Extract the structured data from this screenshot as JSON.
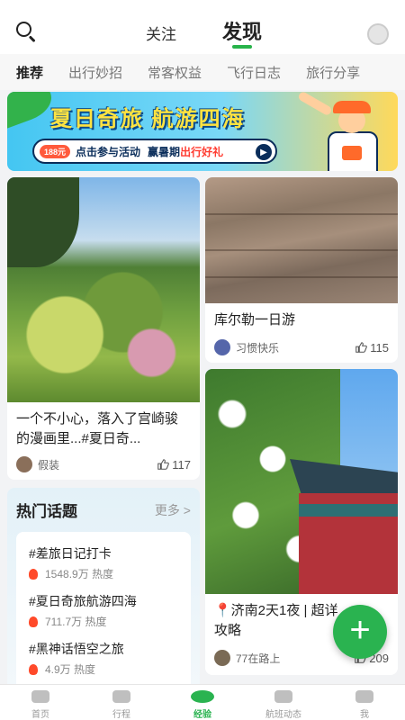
{
  "header": {
    "tabs": [
      {
        "label": "关注"
      },
      {
        "label": "发现"
      }
    ],
    "active_tab": "发现"
  },
  "categories": [
    "推荐",
    "出行妙招",
    "常客权益",
    "飞行日志",
    "旅行分享"
  ],
  "banner": {
    "title": "夏日奇旅 航游四海",
    "badge": "188元",
    "cta_text": "点击参与活动",
    "cta_suffix": "赢暑期",
    "cta_highlight": "出行好礼"
  },
  "feed": {
    "left": [
      {
        "title": "一个不小心，落入了宫崎骏的漫画里...#夏日奇...",
        "author": "假装",
        "likes": "117"
      }
    ],
    "right": [
      {
        "title": "库尔勒一日游",
        "author": "习惯快乐",
        "likes": "115"
      },
      {
        "title": "📍济南2天1夜 | 超详攻略",
        "author": "77在路上",
        "likes": "209"
      }
    ]
  },
  "hot_topics": {
    "title": "热门话题",
    "more": "更多 >",
    "items": [
      {
        "name": "#差旅日记打卡",
        "heat_value": "1548.9万",
        "heat_unit": "热度"
      },
      {
        "name": "#夏日奇旅航游四海",
        "heat_value": "711.7万",
        "heat_unit": "热度"
      },
      {
        "name": "#黑神话悟空之旅",
        "heat_value": "4.9万",
        "heat_unit": "热度"
      }
    ]
  },
  "fab": {
    "label": "+"
  },
  "bottom_nav": [
    {
      "label": "首页"
    },
    {
      "label": "行程"
    },
    {
      "label": "经验"
    },
    {
      "label": "航班动态"
    },
    {
      "label": "我"
    }
  ],
  "colors": {
    "accent": "#2ab350",
    "text": "#222222",
    "muted": "#999999"
  }
}
